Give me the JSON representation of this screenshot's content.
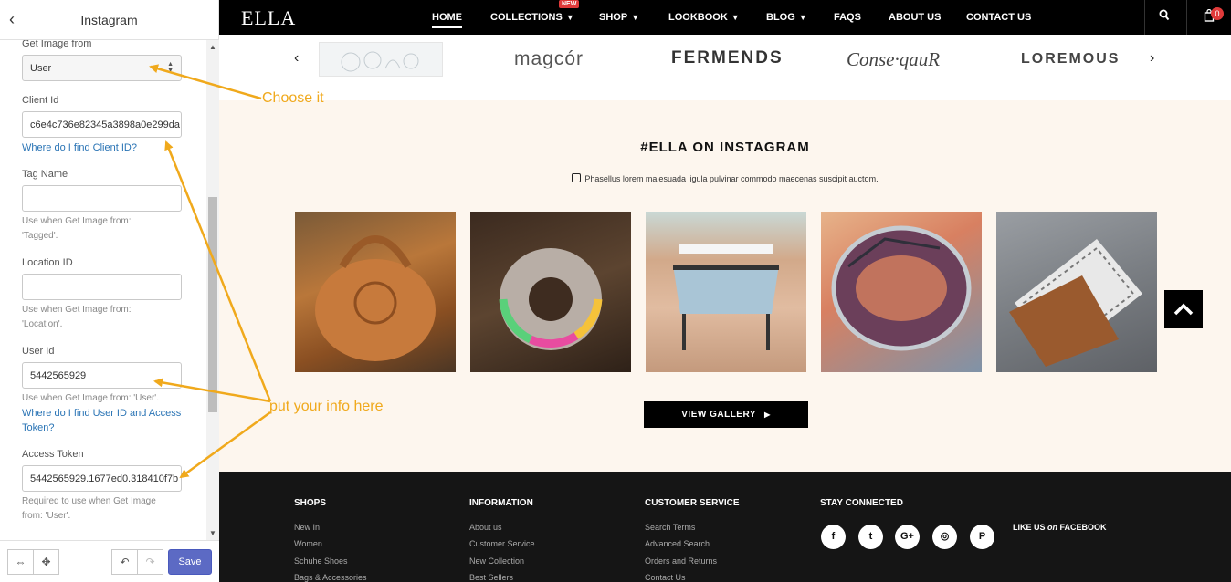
{
  "panel": {
    "back_icon": "chevron-left-icon",
    "title": "Instagram",
    "fields": {
      "get_image": {
        "label": "Get Image from",
        "value": "User"
      },
      "client_id": {
        "label": "Client Id",
        "value": "c6e4c736e82345a3898a0e299da",
        "link": "Where do I find Client ID?"
      },
      "tag_name": {
        "label": "Tag Name",
        "value": "",
        "help1": "Use when Get Image from:",
        "help2": "'Tagged'."
      },
      "location_id": {
        "label": "Location ID",
        "value": "",
        "help1": "Use when Get Image from:",
        "help2": "'Location'."
      },
      "user_id": {
        "label": "User Id",
        "value": "5442565929",
        "help": "Use when Get Image from: 'User'.",
        "link1": "Where do I find User ID and Access",
        "link2": "Token?"
      },
      "access_token": {
        "label": "Access Token",
        "value": "5442565929.1677ed0.318410f7b",
        "help1": "Required to use when Get Image",
        "help2": "from: 'User'."
      }
    },
    "footer": {
      "save_label": "Save"
    }
  },
  "annotations": {
    "choose": "Choose it",
    "info": "put your info here",
    "color": "#f0a91c"
  },
  "nav": {
    "logo": "ELLA",
    "items": [
      "HOME",
      "COLLECTIONS",
      "SHOP",
      "LOOKBOOK",
      "BLOG",
      "FAQS",
      "ABOUT US",
      "CONTACT US"
    ],
    "new_badge": "NEW",
    "cart_count": "0"
  },
  "brands": [
    "magcór",
    "FERMENDS",
    "Conse·qauR",
    "LOREMOUS"
  ],
  "instagram": {
    "title": "#ELLA ON INSTAGRAM",
    "subtitle": "Phasellus lorem malesuada ligula pulvinar commodo maecenas suscipit auctom.",
    "button": "VIEW GALLERY"
  },
  "footer": {
    "cols": [
      {
        "title": "SHOPS",
        "links": [
          "New In",
          "Women",
          "Schuhe Shoes",
          "Bags & Accessories"
        ]
      },
      {
        "title": "INFORMATION",
        "links": [
          "About us",
          "Customer Service",
          "New Collection",
          "Best Sellers"
        ]
      },
      {
        "title": "CUSTOMER SERVICE",
        "links": [
          "Search Terms",
          "Advanced Search",
          "Orders and Returns",
          "Contact Us"
        ]
      },
      {
        "title": "STAY CONNECTED",
        "links": []
      }
    ],
    "social": [
      "facebook-icon",
      "twitter-icon",
      "google-plus-icon",
      "instagram-icon",
      "pinterest-icon"
    ],
    "social_glyphs": [
      "f",
      "t",
      "G+",
      "◎",
      "P"
    ],
    "like_prefix": "LIKE US ",
    "like_on": "on",
    "like_suffix": " FACEBOOK"
  }
}
